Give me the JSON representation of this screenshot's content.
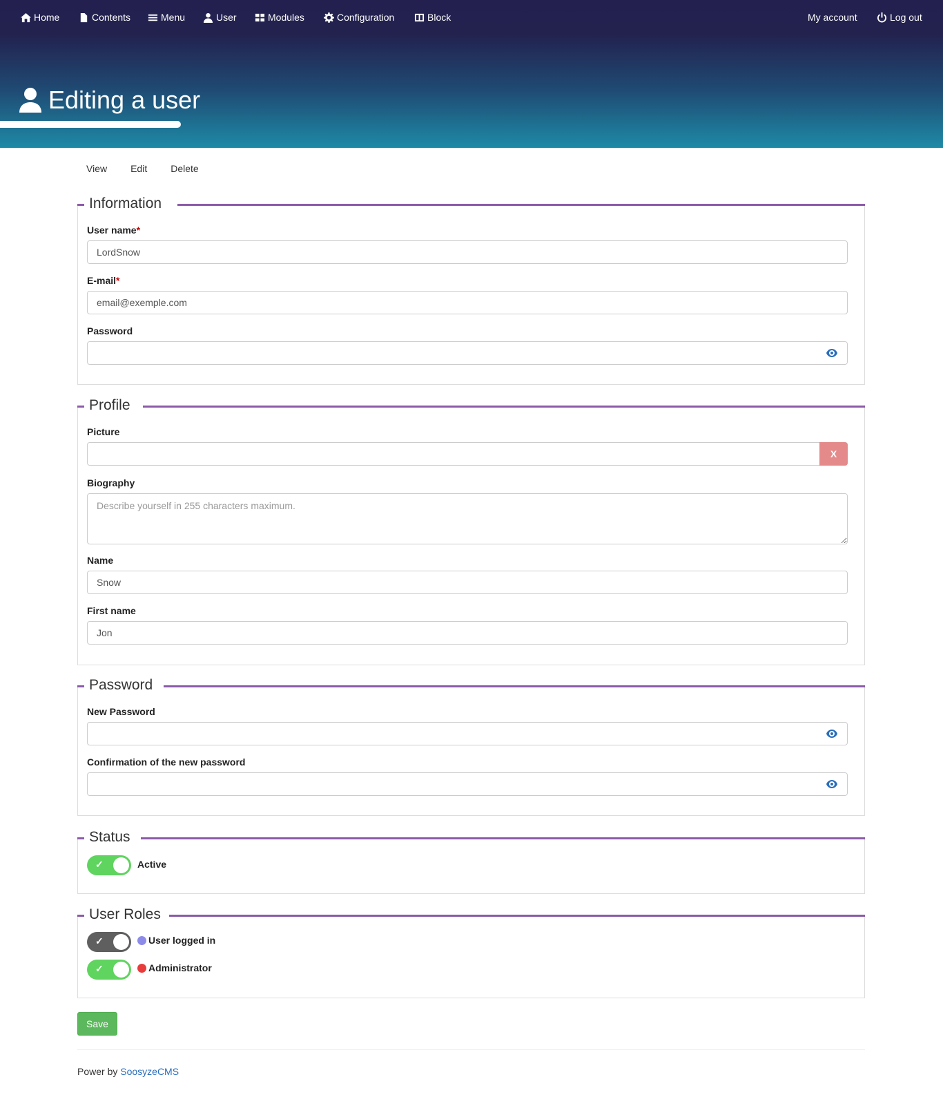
{
  "nav": {
    "home": "Home",
    "contents": "Contents",
    "menu": "Menu",
    "user": "User",
    "modules": "Modules",
    "configuration": "Configuration",
    "block": "Block",
    "my_account": "My account",
    "log_out": "Log out"
  },
  "page": {
    "title": "Editing a user"
  },
  "tabs": {
    "view": "View",
    "edit": "Edit",
    "delete": "Delete"
  },
  "information": {
    "legend": "Information",
    "username_label": "User name",
    "username_value": "LordSnow",
    "email_label": "E-mail",
    "email_value": "email@exemple.com",
    "password_label": "Password",
    "required_mark": "*"
  },
  "profile": {
    "legend": "Profile",
    "picture_label": "Picture",
    "picture_clear": "X",
    "biography_label": "Biography",
    "biography_placeholder": "Describe yourself in 255 characters maximum.",
    "name_label": "Name",
    "name_value": "Snow",
    "firstname_label": "First name",
    "firstname_value": "Jon"
  },
  "password_section": {
    "legend": "Password",
    "new_label": "New Password",
    "confirm_label": "Confirmation of the new password"
  },
  "status": {
    "legend": "Status",
    "active_label": "Active",
    "active_on": true
  },
  "roles": {
    "legend": "User Roles",
    "items": [
      {
        "label": "User logged in",
        "color": "#8c8ce8",
        "checked": true
      },
      {
        "label": "Administrator",
        "color": "#e83c3c",
        "checked": true
      }
    ]
  },
  "actions": {
    "save": "Save"
  },
  "footer": {
    "prefix": "Power by",
    "link": "SoosyzeCMS"
  },
  "colors": {
    "accent": "#8a5aa8",
    "toggle_on": "#5fd45f",
    "save": "#5cb85c",
    "link": "#2a6ebb"
  }
}
